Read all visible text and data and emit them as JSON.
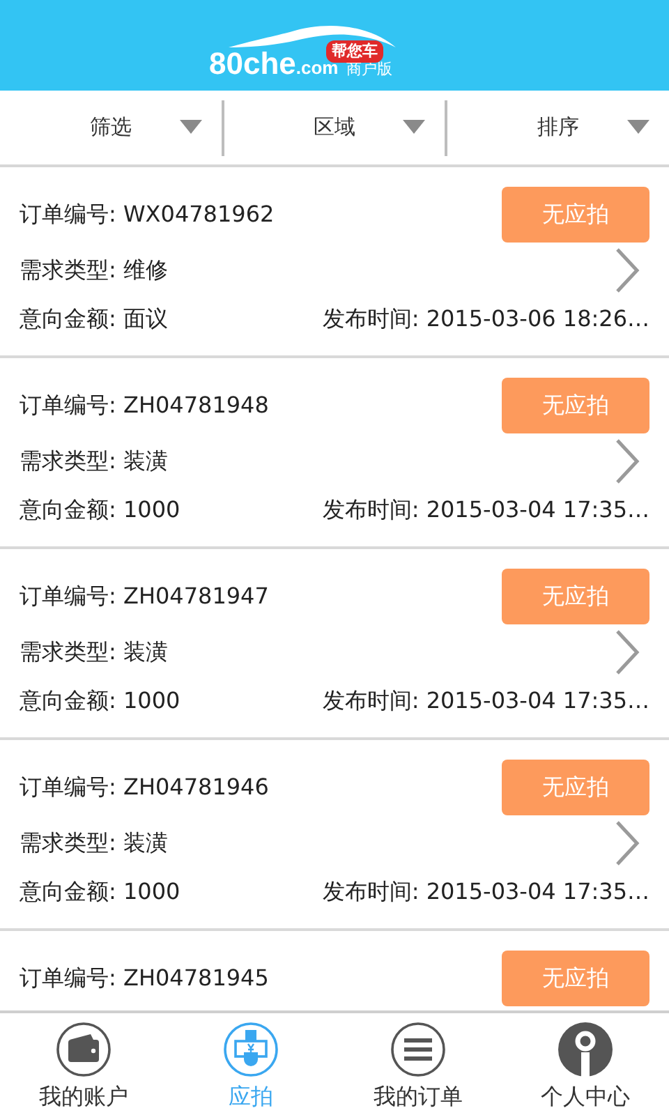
{
  "header": {
    "logo_main": "80che",
    "logo_domain": ".com",
    "logo_badge": "帮您车",
    "logo_edition": "商户版"
  },
  "filters": [
    {
      "label": "筛选"
    },
    {
      "label": "区域"
    },
    {
      "label": "排序"
    }
  ],
  "orders": [
    {
      "order_no": "订单编号: WX04781962",
      "action": "无应拍",
      "type": "需求类型: 维修",
      "amount": "意向金额: 面议",
      "time": "发布时间: 2015-03-06 18:26…"
    },
    {
      "order_no": "订单编号: ZH04781948",
      "action": "无应拍",
      "type": "需求类型: 装潢",
      "amount": "意向金额: 1000",
      "time": "发布时间: 2015-03-04 17:35…"
    },
    {
      "order_no": "订单编号: ZH04781947",
      "action": "无应拍",
      "type": "需求类型: 装潢",
      "amount": "意向金额: 1000",
      "time": "发布时间: 2015-03-04 17:35…"
    },
    {
      "order_no": "订单编号: ZH04781946",
      "action": "无应拍",
      "type": "需求类型: 装潢",
      "amount": "意向金额: 1000",
      "time": "发布时间: 2015-03-04 17:35…"
    },
    {
      "order_no": "订单编号: ZH04781945",
      "action": "无应拍"
    }
  ],
  "tabbar": [
    {
      "label": "我的账户",
      "kind": "wallet",
      "selected": false
    },
    {
      "label": "应拍",
      "kind": "bid",
      "selected": true
    },
    {
      "label": "我的订单",
      "kind": "list",
      "selected": false
    },
    {
      "label": "个人中心",
      "kind": "person",
      "selected": false
    }
  ]
}
